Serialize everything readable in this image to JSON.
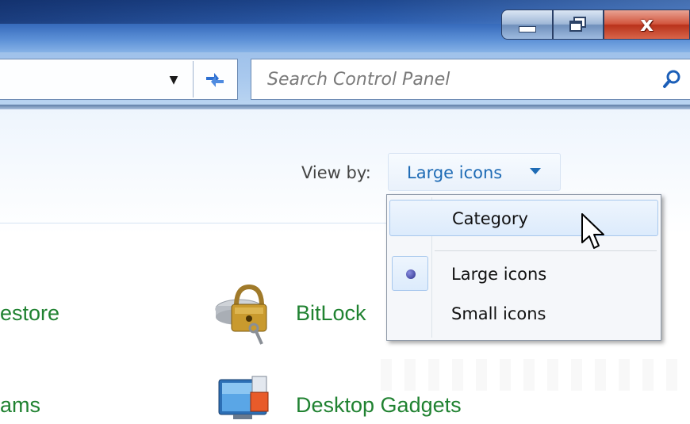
{
  "window": {
    "minimize_icon": "minimize-icon",
    "maximize_icon": "restore-icon",
    "close_glyph": "x"
  },
  "navbar": {
    "refresh_icon": "refresh-icon",
    "search_placeholder": "Search Control Panel",
    "search_icon": "magnifier-icon"
  },
  "toolbar": {
    "view_by_label": "View by:",
    "view_by_value": "Large icons"
  },
  "menu": {
    "items": [
      {
        "label": "Category",
        "state": "hover"
      },
      {
        "label": "Large icons",
        "state": "selected"
      },
      {
        "label": "Small icons",
        "state": "normal"
      }
    ]
  },
  "items": {
    "restore": "estore",
    "programs": "ams",
    "bitlocker": "BitLock",
    "gadgets": "Desktop Gadgets"
  },
  "colors": {
    "link": "#208231",
    "view_value": "#1e6bb5",
    "title_bar": "#2f63b6"
  }
}
